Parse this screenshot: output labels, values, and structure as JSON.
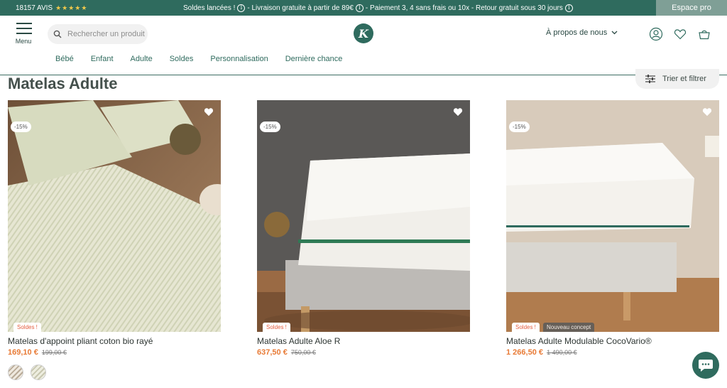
{
  "topbar": {
    "reviews_count": "18157 AVIS",
    "stars": "★★★★★",
    "msg_part1": "Soldes lancées !",
    "msg_part2": "- Livraison gratuite à partir de 89€",
    "msg_part3": "- Paiement 3, 4 sans frais ou 10x - Retour gratuit sous 30 jours",
    "pro_label": "Espace pro"
  },
  "header": {
    "menu_label": "Menu",
    "search_placeholder": "Rechercher un produit",
    "logo_letter": "K",
    "about_label": "À propos de nous",
    "icons": [
      "user-icon",
      "heart-icon",
      "basket-icon"
    ]
  },
  "nav": {
    "items": [
      "Bébé",
      "Enfant",
      "Adulte",
      "Soldes",
      "Personnalisation",
      "Dernière chance"
    ]
  },
  "page": {
    "title": "Matelas Adulte",
    "filter_label": "Trier et filtrer"
  },
  "products": [
    {
      "name": "Matelas d'appoint pliant coton bio rayé",
      "price": "169,10 €",
      "old_price": "199,00 €",
      "discount": "-15%",
      "badge": "Soldes !"
    },
    {
      "name": "Matelas Adulte Aloe R",
      "price": "637,50 €",
      "old_price": "750,00 €",
      "discount": "-15%",
      "badge": "Soldes !"
    },
    {
      "name": "Matelas Adulte Modulable CocoVario®",
      "price": "1 266,50 €",
      "old_price": "1 490,00 €",
      "discount": "-15%",
      "badge": "Soldes !",
      "badge2": "Nouveau concept"
    }
  ],
  "colors": {
    "brand": "#2f6b5e",
    "price": "#e87a35",
    "sale": "#e35d3f"
  }
}
